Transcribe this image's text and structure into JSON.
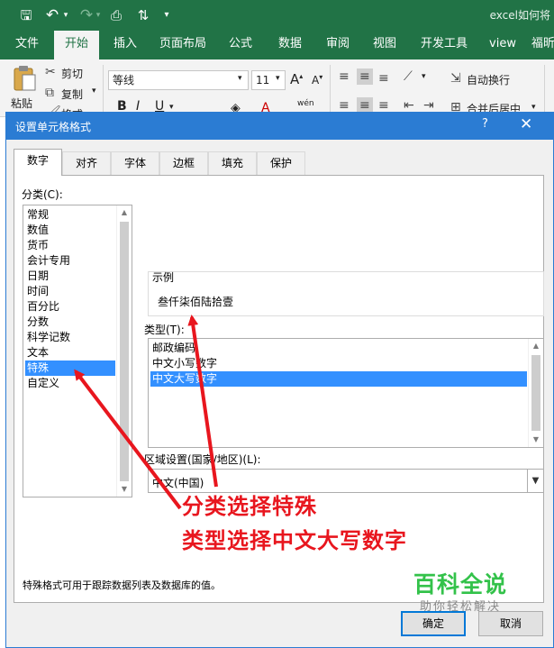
{
  "excel": {
    "doc_title": "excel如何将",
    "quick_access": [
      {
        "name": "save-icon",
        "glyph": "🖫"
      },
      {
        "name": "undo-icon",
        "glyph": "↶"
      },
      {
        "name": "redo-icon",
        "glyph": "↷"
      },
      {
        "name": "print-preview-icon",
        "glyph": "⎙"
      },
      {
        "name": "sort-icon",
        "glyph": "⇅"
      },
      {
        "name": "customize-qat-icon",
        "glyph": "▾"
      }
    ],
    "tabs": [
      "文件",
      "开始",
      "插入",
      "页面布局",
      "公式",
      "数据",
      "审阅",
      "视图",
      "开发工具",
      "view",
      "福昕"
    ],
    "active_tab": "开始",
    "ribbon": {
      "paste": "粘贴",
      "cut": "剪切",
      "copy": "复制",
      "format_painter": "格式",
      "font_name": "等线",
      "font_size": "11",
      "wrap_text": "自动换行",
      "merge_center": "合并后居中"
    }
  },
  "dialog": {
    "title": "设置单元格格式",
    "help": "?",
    "close": "✕",
    "tabs": [
      "数字",
      "对齐",
      "字体",
      "边框",
      "填充",
      "保护"
    ],
    "active_tab": "数字",
    "category_label": "分类(C):",
    "categories": [
      "常规",
      "数值",
      "货币",
      "会计专用",
      "日期",
      "时间",
      "百分比",
      "分数",
      "科学记数",
      "文本",
      "特殊",
      "自定义"
    ],
    "selected_category": "特殊",
    "sample_label": "示例",
    "sample_value": "叁仟柒佰陆拾壹",
    "type_label": "类型(T):",
    "types": [
      "邮政编码",
      "中文小写数字",
      "中文大写数字"
    ],
    "selected_type": "中文大写数字",
    "locale_label": "区域设置(国家/地区)(L):",
    "locale_value": "中文(中国)",
    "description": "特殊格式可用于跟踪数据列表及数据库的值。",
    "ok": "确定",
    "cancel": "取消"
  },
  "annotations": {
    "line1": "分类选择特殊",
    "line2": "类型选择中文大写数字",
    "arrow_color": "#e8161e"
  },
  "watermark": {
    "main": "百科全说",
    "sub": "助你轻松解决"
  }
}
